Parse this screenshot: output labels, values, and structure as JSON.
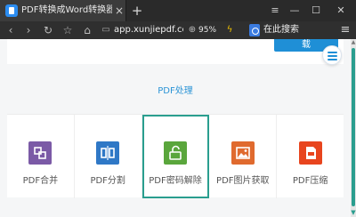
{
  "browser": {
    "tab": {
      "title": "PDF转换成Word转换器在线免费...",
      "close_glyph": "×",
      "icon": "pdf-site-favicon"
    },
    "new_tab_glyph": "+",
    "window": {
      "menu_glyph": "≡",
      "minimize_glyph": "—",
      "maximize_glyph": "☐",
      "close_glyph": "✕"
    },
    "nav": {
      "back_glyph": "‹",
      "forward_glyph": "›",
      "reload_glyph": "↻",
      "bookmark_glyph": "☆",
      "home_glyph": "⌂"
    },
    "address": {
      "lock_glyph": "▭",
      "url": "app.xunjiepdf.co"
    },
    "zoom": {
      "icon_glyph": "⊕",
      "value": "95%"
    },
    "bolt_glyph": "ϟ",
    "search": {
      "engine_icon": "baidu-paw-icon",
      "label": "在此搜索"
    },
    "menu_glyph": "≡"
  },
  "page": {
    "partial_button_label": "载",
    "section_title": "PDF处理",
    "tools": [
      {
        "label": "PDF合并",
        "icon": "merge-icon",
        "color": "#7b5aa6",
        "active": false
      },
      {
        "label": "PDF分割",
        "icon": "split-icon",
        "color": "#2f78c6",
        "active": false
      },
      {
        "label": "PDF密码解除",
        "icon": "unlock-icon",
        "color": "#5aa63c",
        "active": true
      },
      {
        "label": "PDF图片获取",
        "icon": "image-icon",
        "color": "#e06a2e",
        "active": false
      },
      {
        "label": "PDF压缩",
        "icon": "compress-icon",
        "color": "#e8451e",
        "active": false
      }
    ]
  },
  "scrollbar": {
    "up_glyph": "▲",
    "down_glyph": "▼",
    "accent": "#2a9e8f"
  }
}
